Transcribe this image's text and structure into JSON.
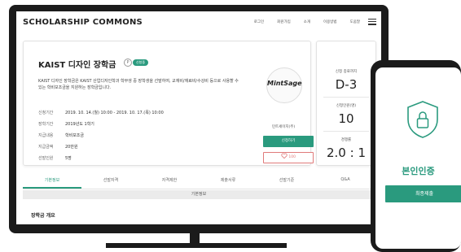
{
  "header": {
    "brand": "SCHOLARSHIP COMMONS",
    "nav": [
      "로그인",
      "회원가입",
      "소개",
      "이용방법",
      "도움말"
    ]
  },
  "scholarship": {
    "title": "KAIST 디자인 장학금",
    "badge": "신청중",
    "description": "KAIST 디자인 장학금은 KAIST 산업디자인학과 학부생 중 장학생을 선발하여, 교재비/재료비/수강비 등으로 사용할 수 있는 학비보조금을 지원하는 장학금입니다.",
    "details": [
      {
        "label": "신청기간",
        "value": "2019. 10. 14.(월) 10:00 - 2019. 10. 17.(목) 10:00"
      },
      {
        "label": "장학기간",
        "value": "2019년도 1학기"
      },
      {
        "label": "지급내용",
        "value": "학비보조금"
      },
      {
        "label": "지급금액",
        "value": "20만원"
      },
      {
        "label": "선발인원",
        "value": "5명"
      }
    ],
    "org_logo": "MintSage",
    "org_name": "민트세이지(주)",
    "apply_label": "신청하기",
    "like_count": "100"
  },
  "stats": [
    {
      "label": "신청 종료까지",
      "value": "D-3"
    },
    {
      "label": "신청인원(명)",
      "value": "10"
    },
    {
      "label": "경쟁률",
      "value": "2.0 : 1"
    }
  ],
  "tabs": [
    "기본정보",
    "선발자격",
    "자격제한",
    "제출서류",
    "선발기준",
    "Q&A"
  ],
  "active_tab": "기본정보",
  "section_title": "기본정보",
  "overview_heading": "장학금 개요",
  "phone": {
    "title": "본인인증",
    "button": "최종제출"
  },
  "colors": {
    "accent": "#2a9a7e",
    "frame": "#1b1b1b",
    "like": "#e07a7a"
  }
}
